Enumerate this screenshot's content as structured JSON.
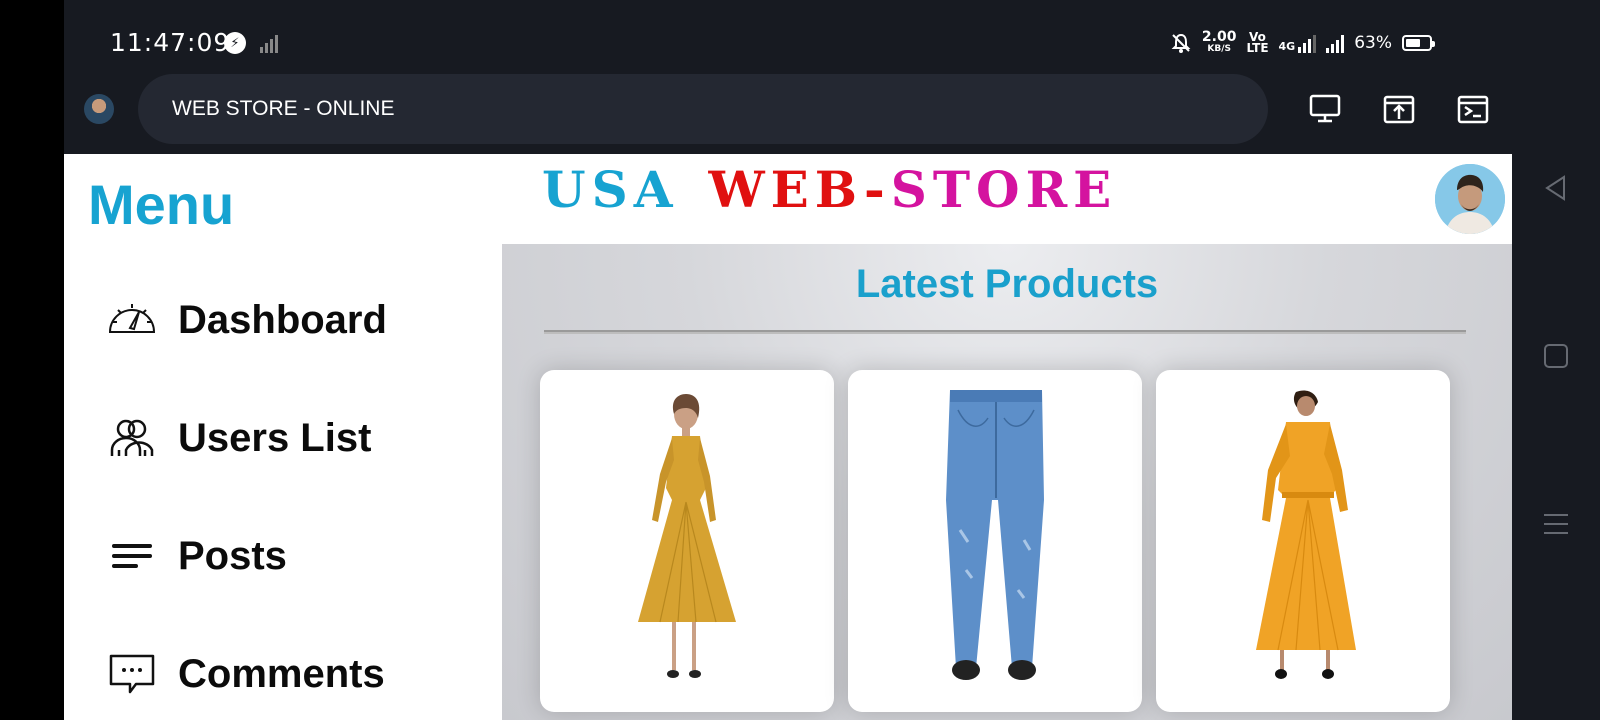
{
  "status_bar": {
    "time": "11:47:09",
    "network_speed_value": "2.00",
    "network_speed_unit": "KB/S",
    "volte_top": "Vo",
    "volte_bottom": "LTE",
    "net_type": "4G",
    "battery_percent": "63%",
    "battery_level": 0.63,
    "icons": [
      "messenger-icon",
      "signal-icon",
      "mute-bell-icon",
      "battery-icon"
    ]
  },
  "browser": {
    "url_title": "WEB STORE - ONLINE",
    "actions": [
      "desktop-icon",
      "share-icon",
      "terminal-icon"
    ]
  },
  "sidebar": {
    "title": "Menu",
    "items": [
      {
        "label": "Dashboard",
        "icon": "speedometer-icon"
      },
      {
        "label": "Users List",
        "icon": "users-icon"
      },
      {
        "label": "Posts",
        "icon": "posts-lines-icon"
      },
      {
        "label": "Comments",
        "icon": "comment-icon"
      }
    ]
  },
  "header": {
    "brand_usa": "USA",
    "brand_web": "WEB-",
    "brand_store": "STORE",
    "colors": {
      "usa": "#17a3d1",
      "web": "#e01010",
      "store": "#d4139f"
    }
  },
  "main": {
    "section_title": "Latest Products",
    "products": [
      {
        "image": "mustard-long-sleeve-dress",
        "color": "#d6a231"
      },
      {
        "image": "blue-denim-jeans",
        "color": "#5d8fc9"
      },
      {
        "image": "orange-long-sleeve-dress-back-view",
        "color": "#f0a326"
      }
    ]
  },
  "system_nav": [
    "back-icon",
    "home-icon",
    "recents-icon"
  ]
}
